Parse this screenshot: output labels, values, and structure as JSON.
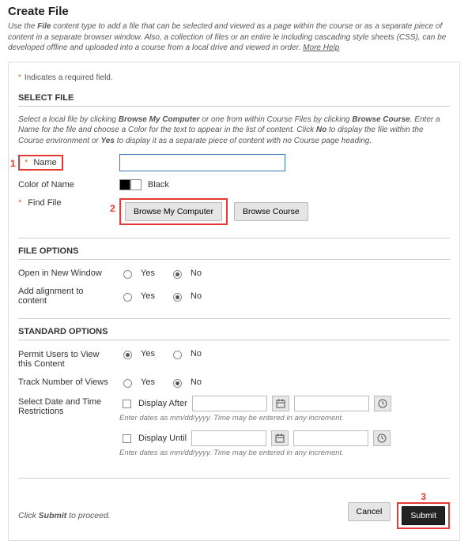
{
  "header": {
    "title": "Create File",
    "intro_html": "Use the <b>File</b> content type to add a file that can be selected and viewed as a page within the course or as a separate piece of content in a separate browser window. Also, a collection of files or an entire le including cascading style sheets (CSS), can be developed offline and uploaded into a course from a local drive and viewed in order.",
    "more_help": "More Help"
  },
  "required_note": "Indicates a required field.",
  "select_file": {
    "title": "SELECT FILE",
    "desc_html": "Select a local file by clicking <b>Browse My Computer</b> or one from within Course Files by clicking <b>Browse Course</b>. Enter a Name for the file and choose a Color for the text to appear in the list of content. Click <b>No</b> to display the file within the Course environment or <b>Yes</b> to display it as a separate piece of content with no Course page heading.",
    "name_label": "Name",
    "name_value": "",
    "color_label": "Color of Name",
    "color_value_label": "Black",
    "find_file_label": "Find File",
    "browse_my_computer": "Browse My Computer",
    "browse_course": "Browse Course"
  },
  "file_options": {
    "title": "FILE OPTIONS",
    "open_new_window": "Open in New Window",
    "add_alignment": "Add alignment to content",
    "yes": "Yes",
    "no": "No"
  },
  "standard_options": {
    "title": "STANDARD OPTIONS",
    "permit_view": "Permit Users to View this Content",
    "track_views": "Track Number of Views",
    "date_restrict": "Select Date and Time Restrictions",
    "display_after": "Display After",
    "display_until": "Display Until",
    "date_hint": "Enter dates as mm/dd/yyyy. Time may be entered in any increment.",
    "yes": "Yes",
    "no": "No"
  },
  "footer": {
    "note_html": "Click <b>Submit</b> to proceed.",
    "cancel": "Cancel",
    "submit": "Submit"
  },
  "callouts": {
    "c1": "1",
    "c2": "2",
    "c3": "3"
  }
}
